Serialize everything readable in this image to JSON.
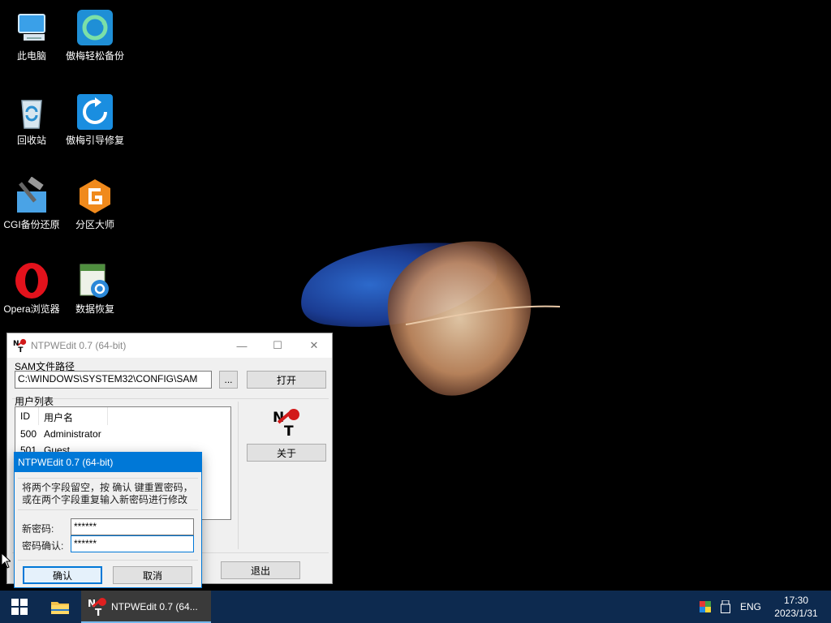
{
  "desktop": {
    "icons": [
      {
        "label": "此电脑",
        "icon": "computer-icon"
      },
      {
        "label": "傲梅轻松备份",
        "icon": "backup-icon"
      },
      {
        "label": "回收站",
        "icon": "recycle-bin-icon"
      },
      {
        "label": "傲梅引导修复",
        "icon": "boot-repair-icon"
      },
      {
        "label": "CGI备份还原",
        "icon": "cgi-backup-icon"
      },
      {
        "label": "分区大师",
        "icon": "partition-icon"
      },
      {
        "label": "Opera浏览器",
        "icon": "opera-icon"
      },
      {
        "label": "数据恢复",
        "icon": "data-recovery-icon"
      }
    ]
  },
  "main_window": {
    "title": "NTPWEdit 0.7 (64-bit)",
    "sam_label": "SAM文件路径",
    "sam_path": "C:\\WINDOWS\\SYSTEM32\\CONFIG\\SAM",
    "browse_label": "...",
    "open_label": "打开",
    "user_list_label": "用户列表",
    "columns": [
      "ID",
      "用户名"
    ],
    "users": [
      {
        "id": "500",
        "name": "Administrator"
      },
      {
        "id": "501",
        "name": "Guest"
      }
    ],
    "about_label": "关于",
    "exit_label": "退出"
  },
  "dialog": {
    "title": "NTPWEdit 0.7 (64-bit)",
    "message_line1": "将两个字段留空，按 确认 键重置密码，",
    "message_line2": "或在两个字段重复输入新密码进行修改",
    "new_password_label": "新密码:",
    "new_password_value": "******",
    "confirm_password_label": "密码确认:",
    "confirm_password_value": "******",
    "ok_label": "确认",
    "cancel_label": "取消"
  },
  "taskbar": {
    "active_app_label": "NTPWEdit 0.7 (64...",
    "language": "ENG",
    "time": "17:30",
    "date": "2023/1/31"
  },
  "colors": {
    "accent": "#0078d7",
    "taskbar": "#0d2a4f"
  }
}
